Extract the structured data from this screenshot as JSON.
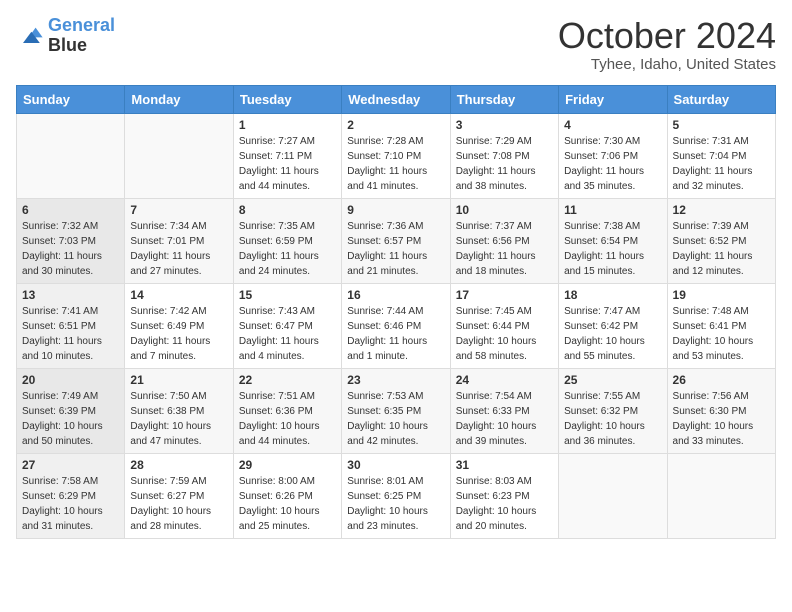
{
  "header": {
    "logo_line1": "General",
    "logo_line2": "Blue",
    "title": "October 2024",
    "subtitle": "Tyhee, Idaho, United States"
  },
  "weekdays": [
    "Sunday",
    "Monday",
    "Tuesday",
    "Wednesday",
    "Thursday",
    "Friday",
    "Saturday"
  ],
  "weeks": [
    [
      {
        "day": "",
        "sunrise": "",
        "sunset": "",
        "daylight": ""
      },
      {
        "day": "",
        "sunrise": "",
        "sunset": "",
        "daylight": ""
      },
      {
        "day": "1",
        "sunrise": "Sunrise: 7:27 AM",
        "sunset": "Sunset: 7:11 PM",
        "daylight": "Daylight: 11 hours and 44 minutes."
      },
      {
        "day": "2",
        "sunrise": "Sunrise: 7:28 AM",
        "sunset": "Sunset: 7:10 PM",
        "daylight": "Daylight: 11 hours and 41 minutes."
      },
      {
        "day": "3",
        "sunrise": "Sunrise: 7:29 AM",
        "sunset": "Sunset: 7:08 PM",
        "daylight": "Daylight: 11 hours and 38 minutes."
      },
      {
        "day": "4",
        "sunrise": "Sunrise: 7:30 AM",
        "sunset": "Sunset: 7:06 PM",
        "daylight": "Daylight: 11 hours and 35 minutes."
      },
      {
        "day": "5",
        "sunrise": "Sunrise: 7:31 AM",
        "sunset": "Sunset: 7:04 PM",
        "daylight": "Daylight: 11 hours and 32 minutes."
      }
    ],
    [
      {
        "day": "6",
        "sunrise": "Sunrise: 7:32 AM",
        "sunset": "Sunset: 7:03 PM",
        "daylight": "Daylight: 11 hours and 30 minutes."
      },
      {
        "day": "7",
        "sunrise": "Sunrise: 7:34 AM",
        "sunset": "Sunset: 7:01 PM",
        "daylight": "Daylight: 11 hours and 27 minutes."
      },
      {
        "day": "8",
        "sunrise": "Sunrise: 7:35 AM",
        "sunset": "Sunset: 6:59 PM",
        "daylight": "Daylight: 11 hours and 24 minutes."
      },
      {
        "day": "9",
        "sunrise": "Sunrise: 7:36 AM",
        "sunset": "Sunset: 6:57 PM",
        "daylight": "Daylight: 11 hours and 21 minutes."
      },
      {
        "day": "10",
        "sunrise": "Sunrise: 7:37 AM",
        "sunset": "Sunset: 6:56 PM",
        "daylight": "Daylight: 11 hours and 18 minutes."
      },
      {
        "day": "11",
        "sunrise": "Sunrise: 7:38 AM",
        "sunset": "Sunset: 6:54 PM",
        "daylight": "Daylight: 11 hours and 15 minutes."
      },
      {
        "day": "12",
        "sunrise": "Sunrise: 7:39 AM",
        "sunset": "Sunset: 6:52 PM",
        "daylight": "Daylight: 11 hours and 12 minutes."
      }
    ],
    [
      {
        "day": "13",
        "sunrise": "Sunrise: 7:41 AM",
        "sunset": "Sunset: 6:51 PM",
        "daylight": "Daylight: 11 hours and 10 minutes."
      },
      {
        "day": "14",
        "sunrise": "Sunrise: 7:42 AM",
        "sunset": "Sunset: 6:49 PM",
        "daylight": "Daylight: 11 hours and 7 minutes."
      },
      {
        "day": "15",
        "sunrise": "Sunrise: 7:43 AM",
        "sunset": "Sunset: 6:47 PM",
        "daylight": "Daylight: 11 hours and 4 minutes."
      },
      {
        "day": "16",
        "sunrise": "Sunrise: 7:44 AM",
        "sunset": "Sunset: 6:46 PM",
        "daylight": "Daylight: 11 hours and 1 minute."
      },
      {
        "day": "17",
        "sunrise": "Sunrise: 7:45 AM",
        "sunset": "Sunset: 6:44 PM",
        "daylight": "Daylight: 10 hours and 58 minutes."
      },
      {
        "day": "18",
        "sunrise": "Sunrise: 7:47 AM",
        "sunset": "Sunset: 6:42 PM",
        "daylight": "Daylight: 10 hours and 55 minutes."
      },
      {
        "day": "19",
        "sunrise": "Sunrise: 7:48 AM",
        "sunset": "Sunset: 6:41 PM",
        "daylight": "Daylight: 10 hours and 53 minutes."
      }
    ],
    [
      {
        "day": "20",
        "sunrise": "Sunrise: 7:49 AM",
        "sunset": "Sunset: 6:39 PM",
        "daylight": "Daylight: 10 hours and 50 minutes."
      },
      {
        "day": "21",
        "sunrise": "Sunrise: 7:50 AM",
        "sunset": "Sunset: 6:38 PM",
        "daylight": "Daylight: 10 hours and 47 minutes."
      },
      {
        "day": "22",
        "sunrise": "Sunrise: 7:51 AM",
        "sunset": "Sunset: 6:36 PM",
        "daylight": "Daylight: 10 hours and 44 minutes."
      },
      {
        "day": "23",
        "sunrise": "Sunrise: 7:53 AM",
        "sunset": "Sunset: 6:35 PM",
        "daylight": "Daylight: 10 hours and 42 minutes."
      },
      {
        "day": "24",
        "sunrise": "Sunrise: 7:54 AM",
        "sunset": "Sunset: 6:33 PM",
        "daylight": "Daylight: 10 hours and 39 minutes."
      },
      {
        "day": "25",
        "sunrise": "Sunrise: 7:55 AM",
        "sunset": "Sunset: 6:32 PM",
        "daylight": "Daylight: 10 hours and 36 minutes."
      },
      {
        "day": "26",
        "sunrise": "Sunrise: 7:56 AM",
        "sunset": "Sunset: 6:30 PM",
        "daylight": "Daylight: 10 hours and 33 minutes."
      }
    ],
    [
      {
        "day": "27",
        "sunrise": "Sunrise: 7:58 AM",
        "sunset": "Sunset: 6:29 PM",
        "daylight": "Daylight: 10 hours and 31 minutes."
      },
      {
        "day": "28",
        "sunrise": "Sunrise: 7:59 AM",
        "sunset": "Sunset: 6:27 PM",
        "daylight": "Daylight: 10 hours and 28 minutes."
      },
      {
        "day": "29",
        "sunrise": "Sunrise: 8:00 AM",
        "sunset": "Sunset: 6:26 PM",
        "daylight": "Daylight: 10 hours and 25 minutes."
      },
      {
        "day": "30",
        "sunrise": "Sunrise: 8:01 AM",
        "sunset": "Sunset: 6:25 PM",
        "daylight": "Daylight: 10 hours and 23 minutes."
      },
      {
        "day": "31",
        "sunrise": "Sunrise: 8:03 AM",
        "sunset": "Sunset: 6:23 PM",
        "daylight": "Daylight: 10 hours and 20 minutes."
      },
      {
        "day": "",
        "sunrise": "",
        "sunset": "",
        "daylight": ""
      },
      {
        "day": "",
        "sunrise": "",
        "sunset": "",
        "daylight": ""
      }
    ]
  ]
}
